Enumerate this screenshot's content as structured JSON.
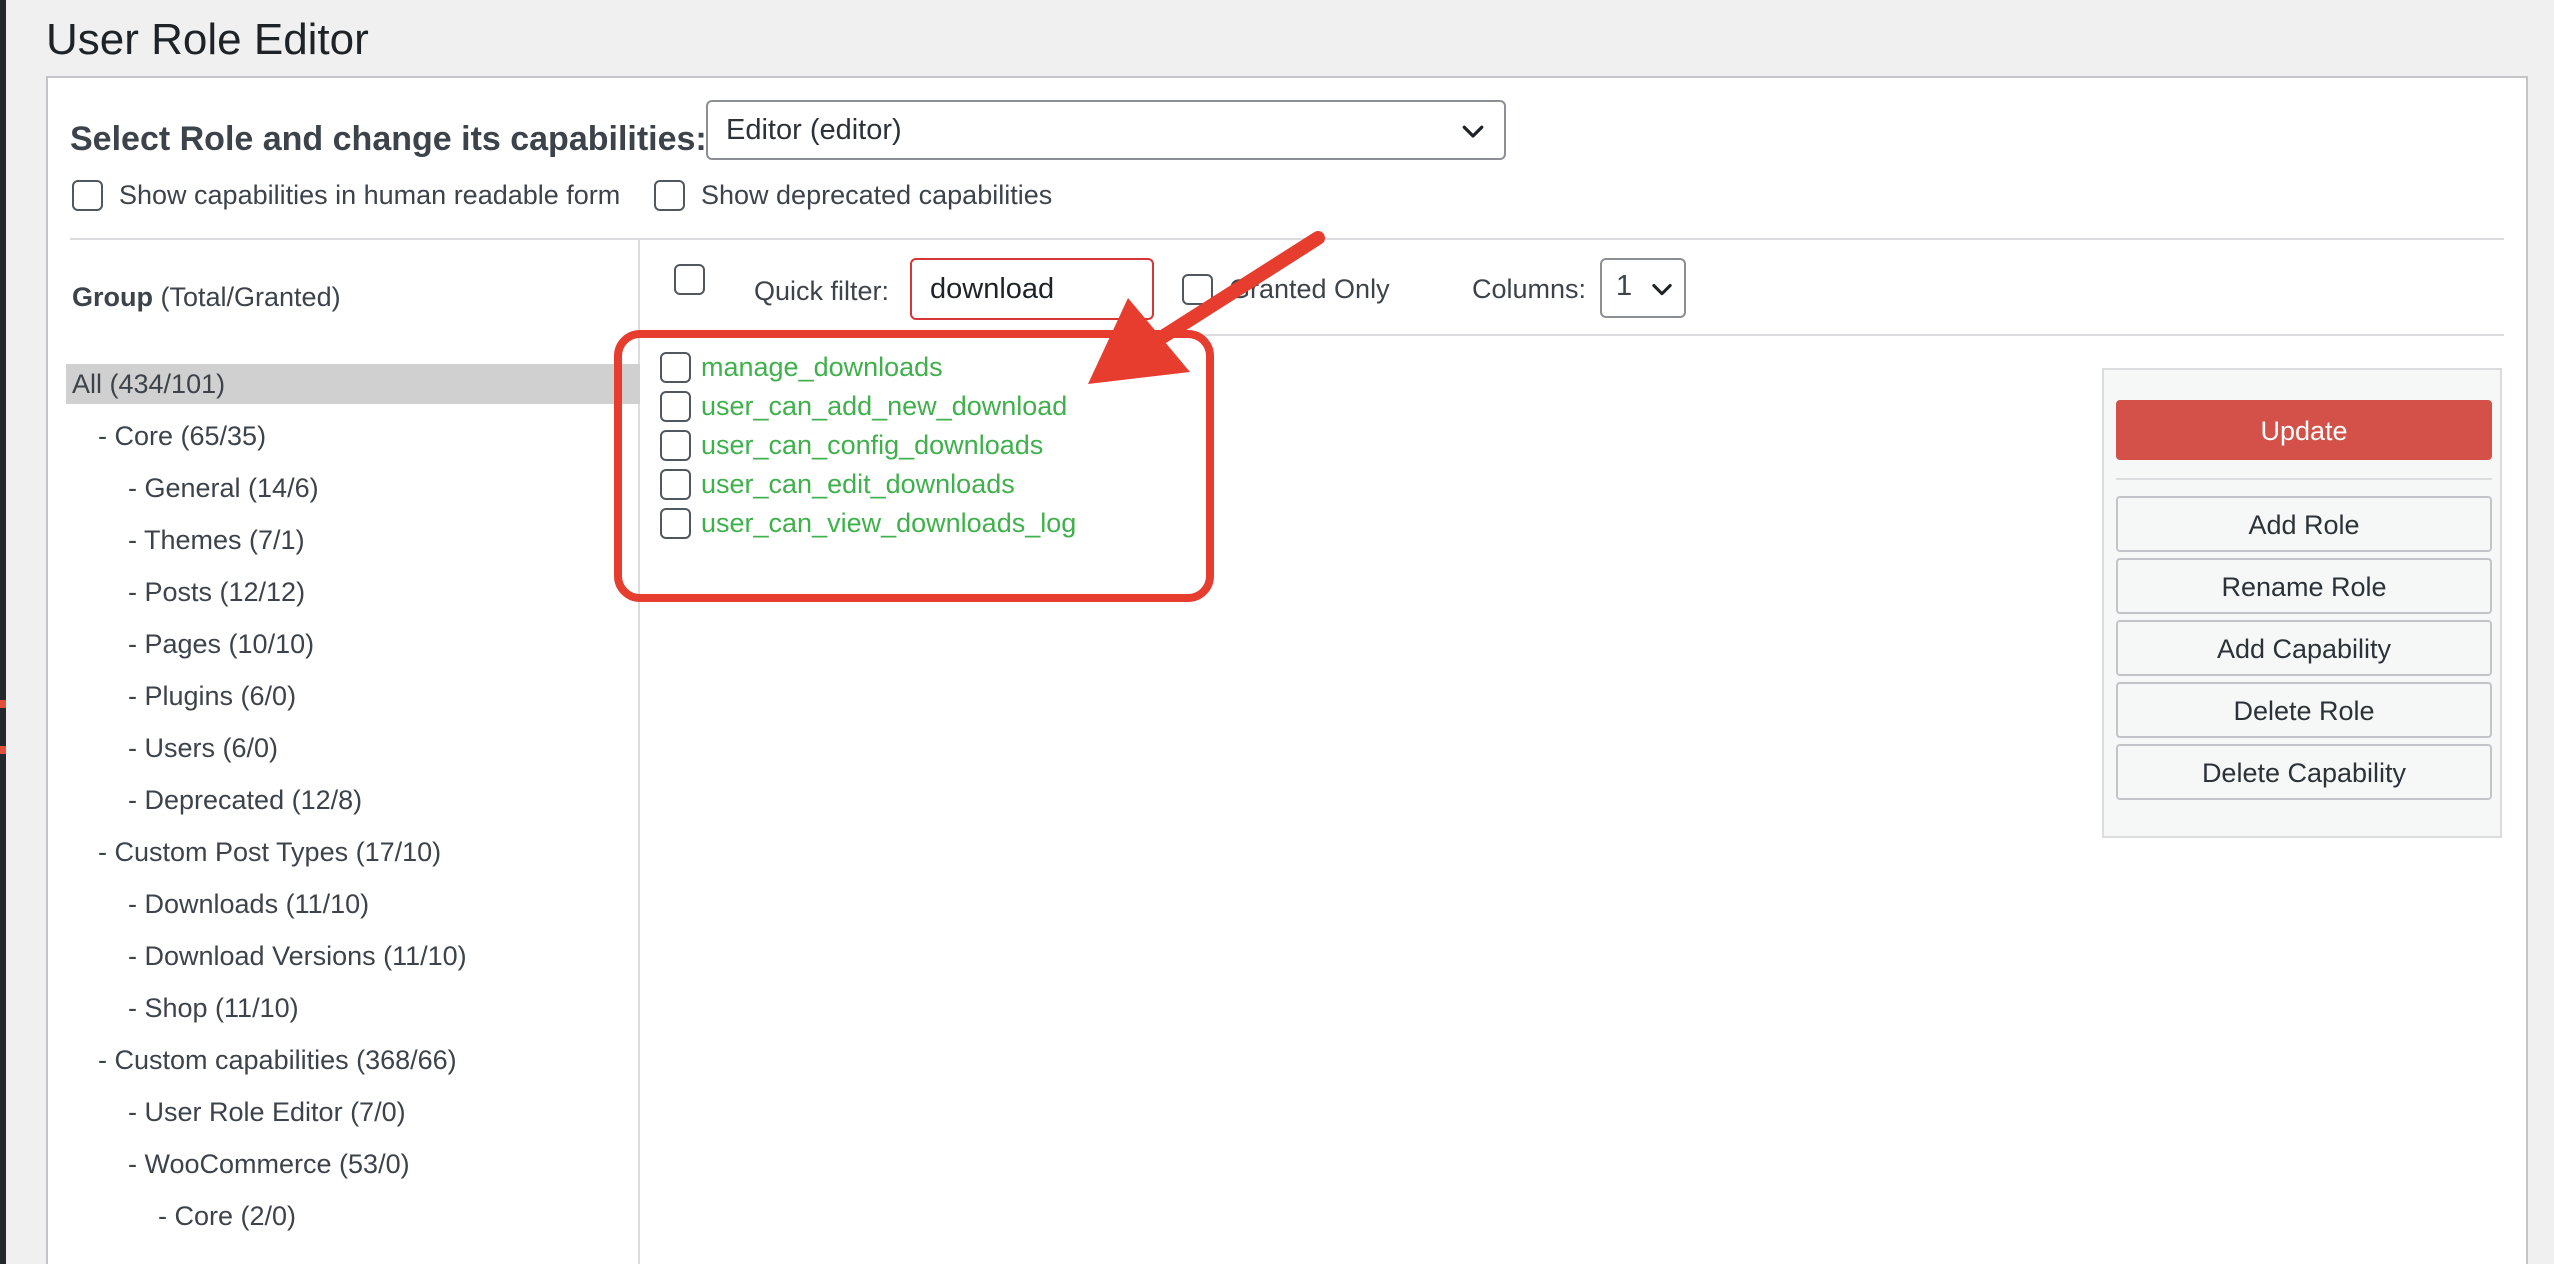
{
  "page": {
    "title": "User Role Editor"
  },
  "role_select": {
    "label": "Select Role and change its capabilities:",
    "selected": "Editor (editor)"
  },
  "options": {
    "human_readable": "Show capabilities in human readable form",
    "deprecated": "Show deprecated capabilities"
  },
  "groups": {
    "header_bold": "Group",
    "header_rest": " (Total/Granted)",
    "items": [
      {
        "label": "All (434/101)",
        "level": 0,
        "active": true
      },
      {
        "label": "- Core (65/35)",
        "level": 1
      },
      {
        "label": "- General (14/6)",
        "level": 2
      },
      {
        "label": "- Themes (7/1)",
        "level": 2
      },
      {
        "label": "- Posts (12/12)",
        "level": 2
      },
      {
        "label": "- Pages (10/10)",
        "level": 2
      },
      {
        "label": "- Plugins (6/0)",
        "level": 2
      },
      {
        "label": "- Users (6/0)",
        "level": 2
      },
      {
        "label": "- Deprecated (12/8)",
        "level": 2
      },
      {
        "label": "- Custom Post Types (17/10)",
        "level": 1
      },
      {
        "label": "- Downloads (11/10)",
        "level": 2
      },
      {
        "label": "- Download Versions (11/10)",
        "level": 2
      },
      {
        "label": "- Shop (11/10)",
        "level": 2
      },
      {
        "label": "- Custom capabilities (368/66)",
        "level": 1
      },
      {
        "label": "- User Role Editor (7/0)",
        "level": 2
      },
      {
        "label": "- WooCommerce (53/0)",
        "level": 2
      },
      {
        "label": "- Core (2/0)",
        "level": 3
      }
    ]
  },
  "filter": {
    "label": "Quick filter:",
    "value": "download",
    "granted_only": "Granted Only",
    "columns_label": "Columns:",
    "columns_value": "1"
  },
  "capabilities": [
    "manage_downloads",
    "user_can_add_new_download",
    "user_can_config_downloads",
    "user_can_edit_downloads",
    "user_can_view_downloads_log"
  ],
  "actions": {
    "update": "Update",
    "add_role": "Add Role",
    "rename_role": "Rename Role",
    "add_capability": "Add Capability",
    "delete_role": "Delete Role",
    "delete_capability": "Delete Capability"
  },
  "colors": {
    "granted_text": "#3fb04b",
    "primary_button": "#d45149",
    "annotation": "#e63d2f"
  }
}
